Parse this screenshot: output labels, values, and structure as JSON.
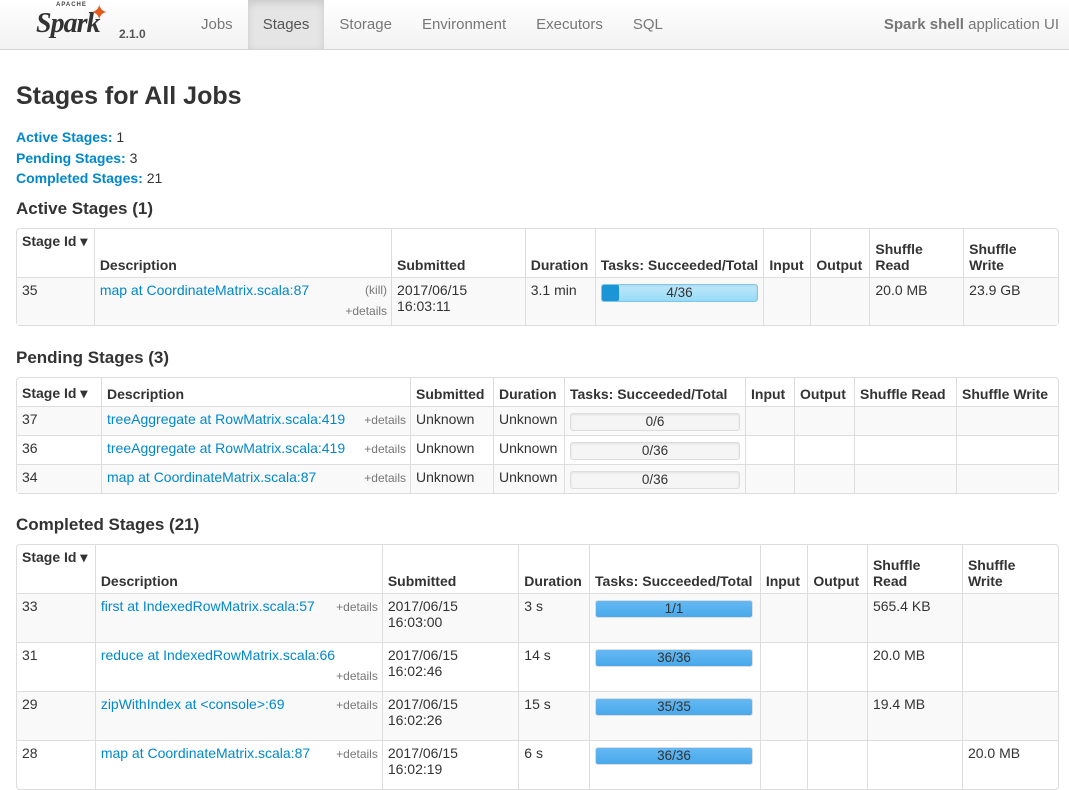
{
  "app": {
    "version": "2.1.0",
    "apache_text": "APACHE",
    "spark_text": "Spark",
    "name_bold": "Spark shell",
    "name_rest": " application UI"
  },
  "nav": {
    "tabs": [
      {
        "label": "Jobs"
      },
      {
        "label": "Stages"
      },
      {
        "label": "Storage"
      },
      {
        "label": "Environment"
      },
      {
        "label": "Executors"
      },
      {
        "label": "SQL"
      }
    ],
    "active": "Stages"
  },
  "page": {
    "title": "Stages for All Jobs",
    "summary": [
      {
        "label": "Active Stages:",
        "value": " 1"
      },
      {
        "label": "Pending Stages:",
        "value": " 3"
      },
      {
        "label": "Completed Stages:",
        "value": " 21"
      }
    ]
  },
  "active": {
    "heading": "Active Stages (1)",
    "headers": [
      "Stage Id ▾",
      "Description",
      "Submitted",
      "Duration",
      "Tasks: Succeeded/Total",
      "Input",
      "Output",
      "Shuffle Read",
      "Shuffle Write"
    ],
    "rows": [
      {
        "id": "35",
        "desc": "map at CoordinateMatrix.scala:87",
        "kill": "(kill)",
        "details": "+details",
        "submitted_date": "2017/06/15",
        "submitted_time": "16:03:11",
        "duration": "3.1 min",
        "tasks": "4/36",
        "progress": 0.111,
        "input": "",
        "output": "",
        "shuffle_read": "20.0 MB",
        "shuffle_write": "23.9 GB"
      }
    ]
  },
  "pending": {
    "heading": "Pending Stages (3)",
    "headers": [
      "Stage Id ▾",
      "Description",
      "Submitted",
      "Duration",
      "Tasks: Succeeded/Total",
      "Input",
      "Output",
      "Shuffle Read",
      "Shuffle Write"
    ],
    "rows": [
      {
        "id": "37",
        "desc": "treeAggregate at RowMatrix.scala:419",
        "details": "+details",
        "submitted": "Unknown",
        "duration": "Unknown",
        "tasks": "0/6"
      },
      {
        "id": "36",
        "desc": "treeAggregate at RowMatrix.scala:419",
        "details": "+details",
        "submitted": "Unknown",
        "duration": "Unknown",
        "tasks": "0/36"
      },
      {
        "id": "34",
        "desc": "map at CoordinateMatrix.scala:87",
        "details": "+details",
        "submitted": "Unknown",
        "duration": "Unknown",
        "tasks": "0/36"
      }
    ]
  },
  "completed": {
    "heading": "Completed Stages (21)",
    "headers": [
      "Stage Id ▾",
      "Description",
      "Submitted",
      "Duration",
      "Tasks: Succeeded/Total",
      "Input",
      "Output",
      "Shuffle Read",
      "Shuffle Write"
    ],
    "rows": [
      {
        "id": "33",
        "desc": "first at IndexedRowMatrix.scala:57",
        "details": "+details",
        "submitted_date": "2017/06/15",
        "submitted_time": "16:03:00",
        "duration": "3 s",
        "tasks": "1/1",
        "shuffle_read": "565.4 KB",
        "shuffle_write": ""
      },
      {
        "id": "31",
        "desc": "reduce at IndexedRowMatrix.scala:66",
        "details": "+details",
        "submitted_date": "2017/06/15",
        "submitted_time": "16:02:46",
        "duration": "14 s",
        "tasks": "36/36",
        "shuffle_read": "20.0 MB",
        "shuffle_write": ""
      },
      {
        "id": "29",
        "desc": "zipWithIndex at <console>:69",
        "details": "+details",
        "submitted_date": "2017/06/15",
        "submitted_time": "16:02:26",
        "duration": "15 s",
        "tasks": "35/35",
        "shuffle_read": "19.4 MB",
        "shuffle_write": ""
      },
      {
        "id": "28",
        "desc": "map at CoordinateMatrix.scala:87",
        "details": "+details",
        "submitted_date": "2017/06/15",
        "submitted_time": "16:02:19",
        "duration": "6 s",
        "tasks": "36/36",
        "shuffle_read": "",
        "shuffle_write": "20.0 MB"
      }
    ]
  },
  "colors": {
    "link": "#0088cc",
    "progress_complete": "#50aff2",
    "brand_star": "#e25a1c"
  }
}
